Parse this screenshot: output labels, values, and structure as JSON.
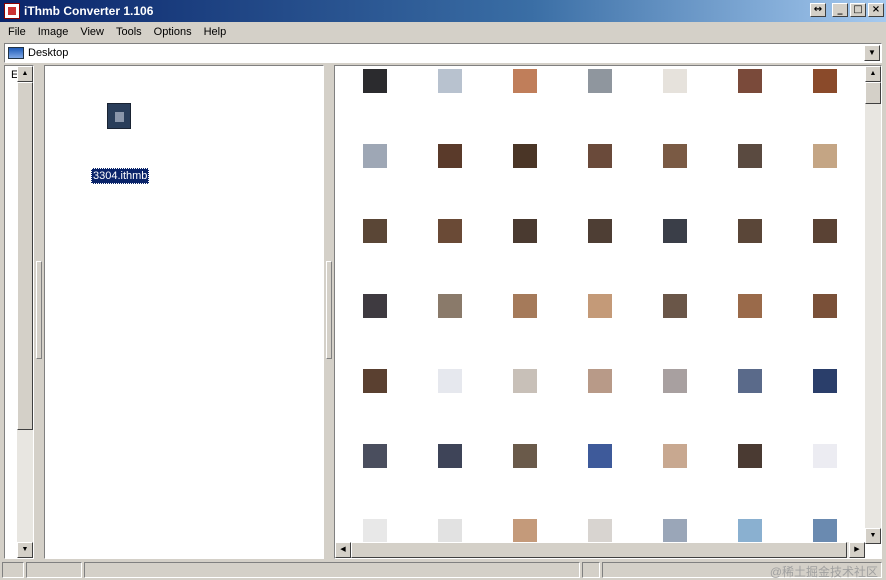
{
  "window": {
    "title": "iThmb Converter 1.106"
  },
  "title_buttons": [
    "↔",
    "_",
    "□",
    "×"
  ],
  "menu": [
    "File",
    "Image",
    "View",
    "Tools",
    "Options",
    "Help"
  ],
  "address": {
    "value": "Desktop"
  },
  "tree": {
    "label": "E"
  },
  "file_list": {
    "selected_file": "3304.ithmb"
  },
  "thumbnail_grid": {
    "columns": 7,
    "rows": [
      [
        "#2b2b2e",
        "#b8c2cf",
        "#c07e5a",
        "#8f969e",
        "#e6e2dc",
        "#7a4a3a",
        "#8a4a2a"
      ],
      [
        "#9ea7b5",
        "#5a3a2a",
        "#4a3526",
        "#6a4a3a",
        "#7a5a44",
        "#5a4a40",
        "#c4a584"
      ],
      [
        "#5a4636",
        "#6a4a36",
        "#4a3a30",
        "#4e3e34",
        "#3a3e48",
        "#5a4638",
        "#5a4234"
      ],
      [
        "#3e3a40",
        "#8a7a6a",
        "#a57a5a",
        "#c49a78",
        "#6a5648",
        "#9a6a4a",
        "#7a5038"
      ],
      [
        "#5a4030",
        "#e6e8ee",
        "#c8c0b8",
        "#b89a88",
        "#a8a0a0",
        "#5a6a8a",
        "#2a3e6a"
      ],
      [
        "#4a4e5e",
        "#3e4458",
        "#6a5a4a",
        "#3e5a9a",
        "#c8a890",
        "#4a3a32",
        "#ececf2"
      ],
      [
        "#e8e8e8",
        "#e2e2e2",
        "#c49a7a",
        "#d8d4d0",
        "#9aa6b8",
        "#8ab0d0",
        "#6a8ab0"
      ]
    ]
  },
  "status": {
    "watermark": "@稀土掘金技术社区"
  }
}
